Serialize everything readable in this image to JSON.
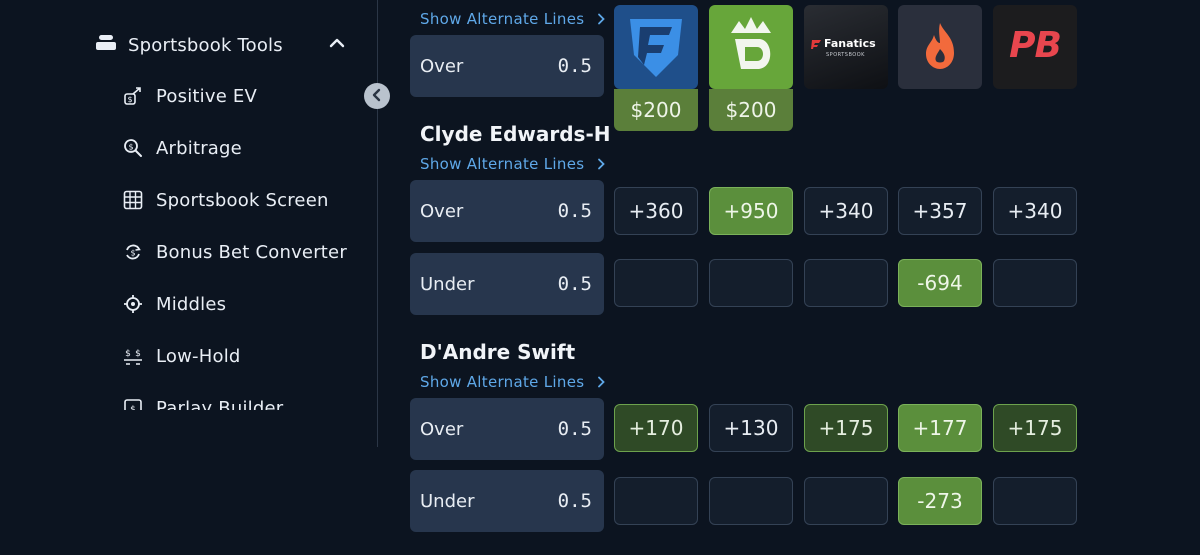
{
  "sidebar": {
    "section_title": "Sportsbook Tools",
    "items": [
      {
        "label": "Positive EV",
        "icon": "positive-ev-icon"
      },
      {
        "label": "Arbitrage",
        "icon": "arbitrage-icon"
      },
      {
        "label": "Sportsbook Screen",
        "icon": "grid-icon"
      },
      {
        "label": "Bonus Bet Converter",
        "icon": "bonus-convert-icon"
      },
      {
        "label": "Middles",
        "icon": "target-icon"
      },
      {
        "label": "Low-Hold",
        "icon": "low-hold-icon"
      },
      {
        "label": "Parlay Builder",
        "icon": "parlay-icon"
      }
    ]
  },
  "books": [
    {
      "name": "FanDuel",
      "icon": "fanduel-logo",
      "promo": "$200"
    },
    {
      "name": "DraftKings",
      "icon": "draftkings-logo",
      "promo": "$200"
    },
    {
      "name": "Fanatics",
      "icon": "fanatics-logo",
      "logo_text": "Fanatics",
      "logo_sub": "SPORTSBOOK"
    },
    {
      "name": "Hard Rock",
      "icon": "flame-logo"
    },
    {
      "name": "PointsBet",
      "icon": "pointsbet-logo",
      "logo_text": "PB"
    }
  ],
  "alt_lines_label": "Show Alternate Lines",
  "top_market": {
    "side": "Over",
    "line": "0.5"
  },
  "players": [
    {
      "name": "Clyde Edwards-H...",
      "rows": [
        {
          "side": "Over",
          "line": "0.5",
          "odds": [
            "+360",
            "+950",
            "+340",
            "+357",
            "+340"
          ]
        },
        {
          "side": "Under",
          "line": "0.5",
          "odds": [
            "",
            "",
            "",
            "-694",
            ""
          ]
        }
      ]
    },
    {
      "name": "D'Andre Swift",
      "rows": [
        {
          "side": "Over",
          "line": "0.5",
          "odds": [
            "+170",
            "+130",
            "+175",
            "+177",
            "+175"
          ]
        },
        {
          "side": "Under",
          "line": "0.5",
          "odds": [
            "",
            "",
            "",
            "-273",
            ""
          ]
        }
      ]
    }
  ],
  "colors": {
    "background": "#0c1420",
    "link": "#5fa8e8",
    "best_odds": "#5b8f3c",
    "good_odds": "#2f4a26",
    "line_box": "#27364d"
  }
}
